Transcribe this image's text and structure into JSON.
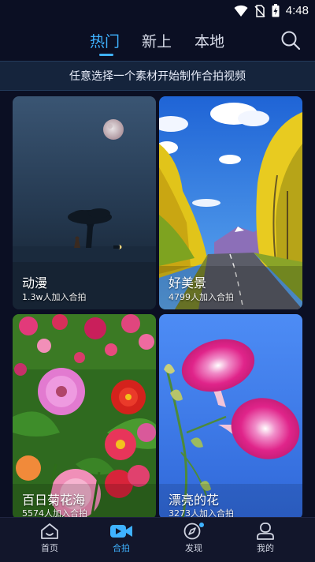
{
  "status_bar": {
    "time": "4:48"
  },
  "tabs": [
    {
      "label": "热门"
    },
    {
      "label": "新上"
    },
    {
      "label": "本地"
    }
  ],
  "banner": {
    "text": "任意选择一个素材开始制作合拍视频"
  },
  "cards": [
    {
      "title": "动漫",
      "subtitle": "1.3w人加入合拍"
    },
    {
      "title": "好美景",
      "subtitle": "4799人加入合拍"
    },
    {
      "title": "百日菊花海",
      "subtitle": "5574人加入合拍"
    },
    {
      "title": "漂亮的花",
      "subtitle": "3273人加入合拍"
    }
  ],
  "bottom_nav": [
    {
      "label": "首页",
      "icon": "home-icon"
    },
    {
      "label": "合拍",
      "icon": "video-camera-icon"
    },
    {
      "label": "发现",
      "icon": "compass-icon"
    },
    {
      "label": "我的",
      "icon": "user-icon"
    }
  ],
  "colors": {
    "accent": "#3fb2ff",
    "background": "#0b0f23"
  }
}
